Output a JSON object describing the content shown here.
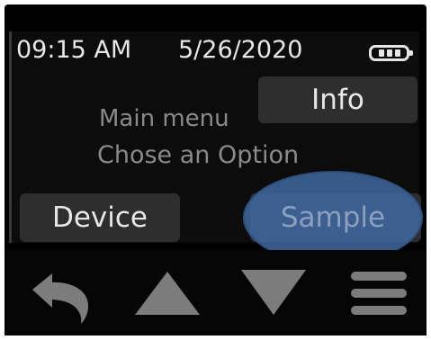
{
  "status": {
    "time": "09:15 AM",
    "date": "5/26/2020",
    "battery_icon": "battery-full-icon"
  },
  "menu": {
    "title": "Main menu",
    "subtitle": "Chose an Option"
  },
  "buttons": {
    "info": "Info",
    "device": "Device",
    "sample": "Sample"
  },
  "nav": {
    "icons": [
      "back-arrow-icon",
      "up-arrow-icon",
      "down-arrow-icon",
      "menu-icon"
    ]
  },
  "colors": {
    "highlight": "#3f68a0",
    "button_bg": "#2e2e2e",
    "text": "#e6e6e6"
  }
}
